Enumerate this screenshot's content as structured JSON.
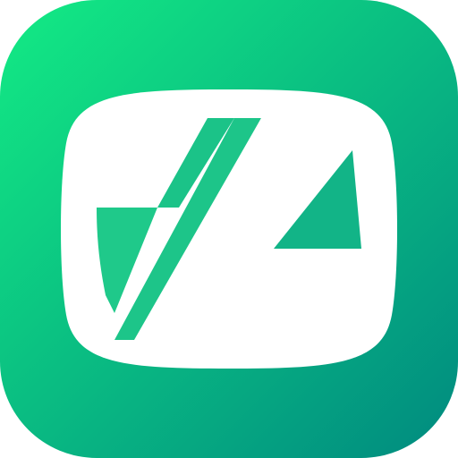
{
  "icon": {
    "name": "app-icon",
    "glyph": "slashed-rounded-square-logo",
    "colors": {
      "gradient_start": "#13EB84",
      "gradient_end": "#008A80",
      "glyph": "#FFFFFF"
    }
  }
}
